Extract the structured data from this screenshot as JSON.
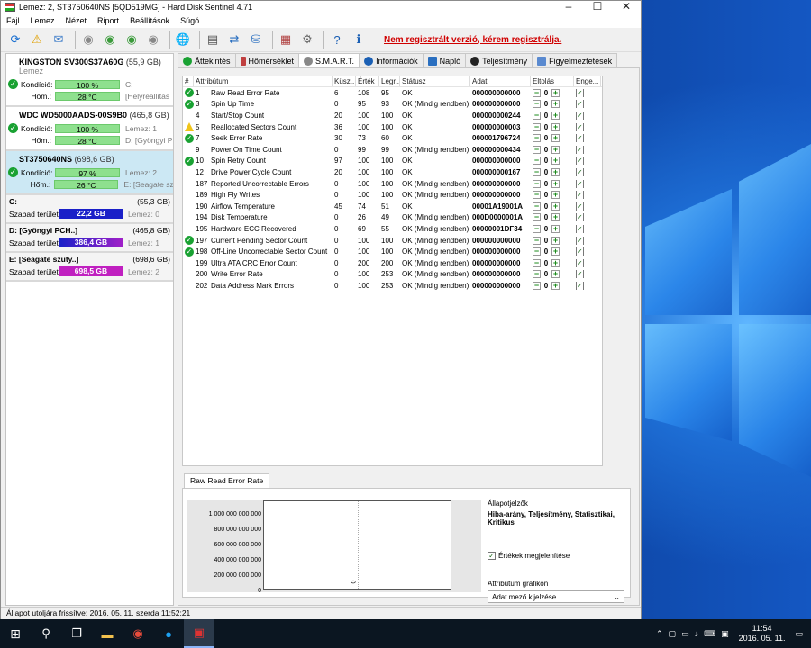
{
  "window": {
    "title": "Lemez: 2, ST3750640NS [5QD519MG]  -  Hard Disk Sentinel 4.71",
    "controls": [
      "–",
      "☐",
      "✕"
    ]
  },
  "menu": [
    "Fájl",
    "Lemez",
    "Nézet",
    "Riport",
    "Beállítások",
    "Súgó"
  ],
  "reg_warning": "Nem regisztrált verzió, kérem regisztrálja.",
  "drives": [
    {
      "name": "KINGSTON SV300S37A60G",
      "size": "(55,9 GB)",
      "side_name": "Lemez",
      "kondicio_label": "Kondíció:",
      "kondicio": "100 %",
      "kondicio_side": "C:",
      "hom_label": "Hőm.:",
      "hom": "28 °C",
      "hom_side": "[Helyreállítás"
    },
    {
      "name": "WDC WD5000AADS-00S9B0",
      "size": "(465,8 GB)",
      "side_name": "",
      "kondicio_label": "Kondíció:",
      "kondicio": "100 %",
      "kondicio_side": "Lemez: 1",
      "hom_label": "Hőm.:",
      "hom": "28 °C",
      "hom_side": "D: [Gyöngyi P"
    },
    {
      "name": "ST3750640NS",
      "size": "(698,6 GB)",
      "side_name": "",
      "kondicio_label": "Kondíció:",
      "kondicio": "97 %",
      "kondicio_side": "Lemez: 2",
      "hom_label": "Hőm.:",
      "hom": "26 °C",
      "hom_side": "E: [Seagate sz"
    }
  ],
  "partitions": [
    {
      "name": "C:",
      "size": "(55,3 GB)",
      "label": "Szabad terület",
      "free": "22,2 GB",
      "disk": "Lemez: 0",
      "color": "#1a20c8"
    },
    {
      "name": "D: [Gyöngyi PCH..]",
      "size": "(465,8 GB)",
      "label": "Szabad terület",
      "free": "386,4 GB",
      "disk": "Lemez: 1",
      "color": "#6b16c8"
    },
    {
      "name": "E: [Seagate szuty..]",
      "size": "(698,6 GB)",
      "label": "Szabad terület",
      "free": "698,5 GB",
      "disk": "Lemez: 2",
      "color": "#c020c0"
    }
  ],
  "tabs": [
    "Áttekintés",
    "Hőmérséklet",
    "S.M.A.R.T.",
    "Információk",
    "Napló",
    "Teljesítmény",
    "Figyelmeztetések"
  ],
  "table": {
    "headers": [
      "#",
      "Attribútum",
      "Küsz...",
      "Érték",
      "Legr...",
      "Státusz",
      "Adat",
      "Eltolás",
      "Enge..."
    ],
    "rows": [
      {
        "icon": "ok",
        "no": "1",
        "attr": "Raw Read Error Rate",
        "th": "6",
        "val": "108",
        "worst": "95",
        "status": "OK",
        "data": "000000000000",
        "offset": "0"
      },
      {
        "icon": "ok",
        "no": "3",
        "attr": "Spin Up Time",
        "th": "0",
        "val": "95",
        "worst": "93",
        "status": "OK (Mindig rendben)",
        "data": "000000000000",
        "offset": "0"
      },
      {
        "icon": "",
        "no": "4",
        "attr": "Start/Stop Count",
        "th": "20",
        "val": "100",
        "worst": "100",
        "status": "OK",
        "data": "000000000244",
        "offset": "0"
      },
      {
        "icon": "warn",
        "no": "5",
        "attr": "Reallocated Sectors Count",
        "th": "36",
        "val": "100",
        "worst": "100",
        "status": "OK",
        "data": "000000000003",
        "offset": "0"
      },
      {
        "icon": "ok",
        "no": "7",
        "attr": "Seek Error Rate",
        "th": "30",
        "val": "73",
        "worst": "60",
        "status": "OK",
        "data": "000001796724",
        "offset": "0"
      },
      {
        "icon": "",
        "no": "9",
        "attr": "Power On Time Count",
        "th": "0",
        "val": "99",
        "worst": "99",
        "status": "OK (Mindig rendben)",
        "data": "000000000434",
        "offset": "0"
      },
      {
        "icon": "ok",
        "no": "10",
        "attr": "Spin Retry Count",
        "th": "97",
        "val": "100",
        "worst": "100",
        "status": "OK",
        "data": "000000000000",
        "offset": "0"
      },
      {
        "icon": "",
        "no": "12",
        "attr": "Drive Power Cycle Count",
        "th": "20",
        "val": "100",
        "worst": "100",
        "status": "OK",
        "data": "000000000167",
        "offset": "0"
      },
      {
        "icon": "",
        "no": "187",
        "attr": "Reported Uncorrectable Errors",
        "th": "0",
        "val": "100",
        "worst": "100",
        "status": "OK (Mindig rendben)",
        "data": "000000000000",
        "offset": "0"
      },
      {
        "icon": "",
        "no": "189",
        "attr": "High Fly Writes",
        "th": "0",
        "val": "100",
        "worst": "100",
        "status": "OK (Mindig rendben)",
        "data": "000000000000",
        "offset": "0"
      },
      {
        "icon": "",
        "no": "190",
        "attr": "Airflow Temperature",
        "th": "45",
        "val": "74",
        "worst": "51",
        "status": "OK",
        "data": "00001A19001A",
        "offset": "0"
      },
      {
        "icon": "",
        "no": "194",
        "attr": "Disk Temperature",
        "th": "0",
        "val": "26",
        "worst": "49",
        "status": "OK (Mindig rendben)",
        "data": "000D0000001A",
        "offset": "0"
      },
      {
        "icon": "",
        "no": "195",
        "attr": "Hardware ECC Recovered",
        "th": "0",
        "val": "69",
        "worst": "55",
        "status": "OK (Mindig rendben)",
        "data": "00000001DF34",
        "offset": "0"
      },
      {
        "icon": "ok",
        "no": "197",
        "attr": "Current Pending Sector Count",
        "th": "0",
        "val": "100",
        "worst": "100",
        "status": "OK (Mindig rendben)",
        "data": "000000000000",
        "offset": "0"
      },
      {
        "icon": "ok",
        "no": "198",
        "attr": "Off-Line Uncorrectable Sector Count",
        "th": "0",
        "val": "100",
        "worst": "100",
        "status": "OK (Mindig rendben)",
        "data": "000000000000",
        "offset": "0"
      },
      {
        "icon": "",
        "no": "199",
        "attr": "Ultra ATA CRC Error Count",
        "th": "0",
        "val": "200",
        "worst": "200",
        "status": "OK (Mindig rendben)",
        "data": "000000000000",
        "offset": "0"
      },
      {
        "icon": "",
        "no": "200",
        "attr": "Write Error Rate",
        "th": "0",
        "val": "100",
        "worst": "253",
        "status": "OK (Mindig rendben)",
        "data": "000000000000",
        "offset": "0"
      },
      {
        "icon": "",
        "no": "202",
        "attr": "Data Address Mark Errors",
        "th": "0",
        "val": "100",
        "worst": "253",
        "status": "OK (Mindig rendben)",
        "data": "000000000000",
        "offset": "0"
      }
    ]
  },
  "graph": {
    "tab": "Raw Read Error Rate",
    "y_ticks": [
      "1 000 000 000 000",
      "800 000 000 000",
      "600 000 000 000",
      "400 000 000 000",
      "200 000 000 000",
      "0"
    ],
    "x_label": "0",
    "state_label": "Állapotjelzők",
    "state_values": "Hiba-arány, Teljesítmény, Statisztikai, Kritikus",
    "show_values": "Értékek megjelenítése",
    "attr_graph_label": "Attribútum grafikon",
    "attr_graph_value": "Adat mező kijelzése"
  },
  "statusbar": "Állapot utoljára frissítve: 2016. 05. 11. szerda 11:52:21",
  "taskbar": {
    "time": "11:54",
    "date": "2016. 05. 11."
  }
}
